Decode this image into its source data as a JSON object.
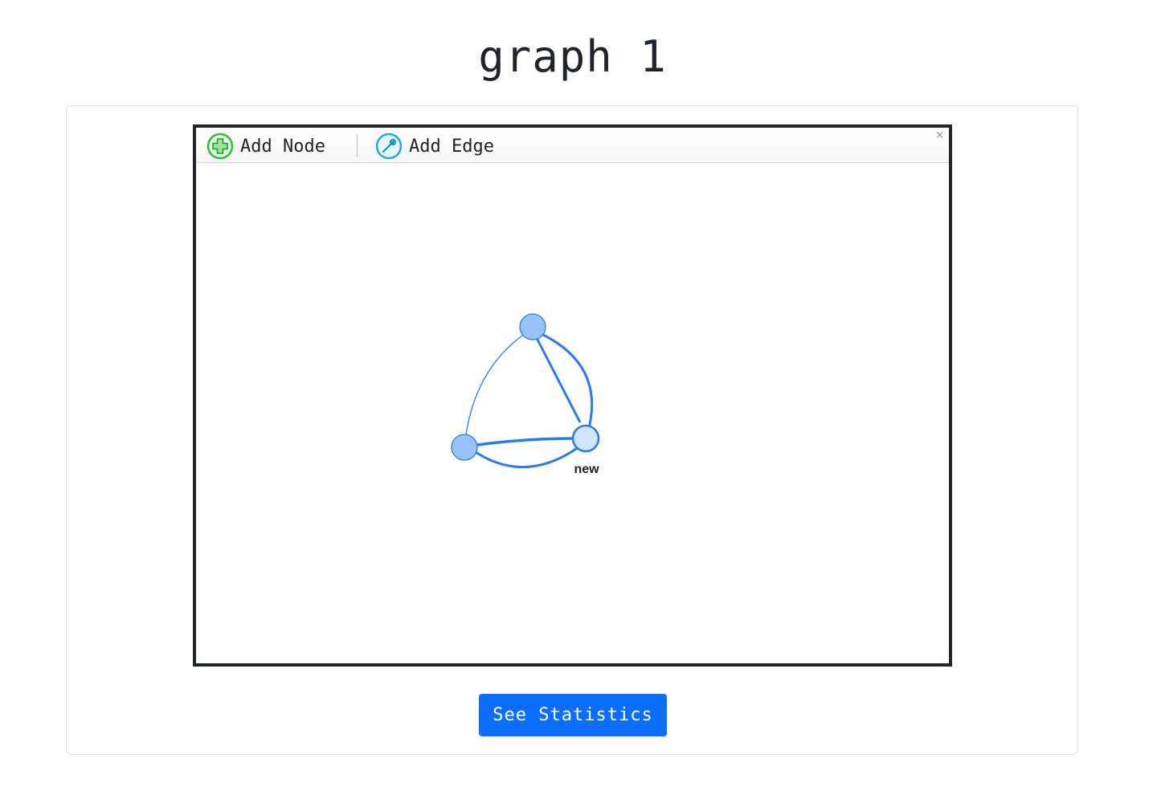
{
  "page": {
    "title": "graph 1"
  },
  "toolbar": {
    "add_node_label": "Add Node",
    "add_edge_label": "Add Edge",
    "close_label": "×"
  },
  "graph": {
    "nodes": [
      {
        "id": "top",
        "label": ""
      },
      {
        "id": "left",
        "label": ""
      },
      {
        "id": "new",
        "label": "new"
      }
    ],
    "edges": [
      {
        "from": "top",
        "to": "left"
      },
      {
        "from": "top",
        "to": "new"
      },
      {
        "from": "top",
        "to": "new"
      },
      {
        "from": "left",
        "to": "new"
      },
      {
        "from": "left",
        "to": "new"
      }
    ]
  },
  "actions": {
    "stats_label": "See Statistics"
  },
  "colors": {
    "primary": "#0d6efd",
    "edge": "#2b7ce9",
    "node_fill": "#97c2fc",
    "node_selected_fill": "#d2e5ff",
    "node_border": "#2b7ce9",
    "add_node_icon": "#2fbe2f",
    "add_edge_icon": "#29a8e0"
  }
}
